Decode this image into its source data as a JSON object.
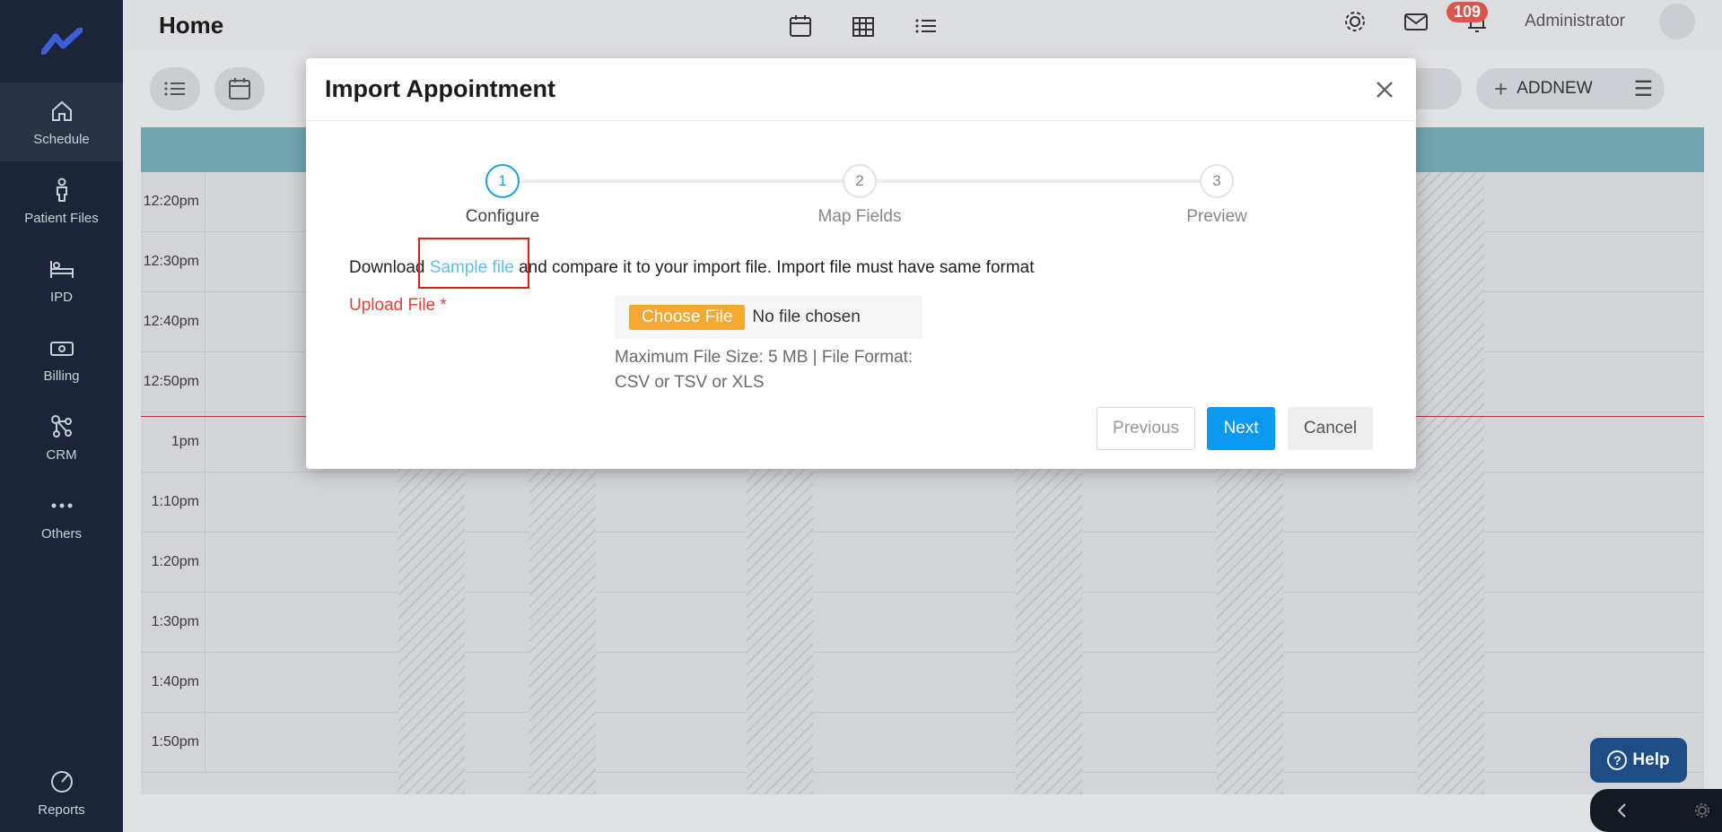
{
  "sidebar": {
    "items": [
      {
        "label": "Schedule",
        "icon": "home-icon"
      },
      {
        "label": "Patient Files",
        "icon": "person-icon"
      },
      {
        "label": "IPD",
        "icon": "bed-icon"
      },
      {
        "label": "Billing",
        "icon": "cash-icon"
      },
      {
        "label": "CRM",
        "icon": "network-icon"
      },
      {
        "label": "Others",
        "icon": "more-dots-icon"
      }
    ],
    "bottom_item": {
      "label": "Reports",
      "icon": "pie-chart-icon"
    }
  },
  "header": {
    "title": "Home",
    "notification_count": "109",
    "user_name": "Administrator"
  },
  "toolbar": {
    "addnew_label": "ADDNEW"
  },
  "schedule": {
    "times": [
      "12:20pm",
      "12:30pm",
      "12:40pm",
      "12:50pm",
      "1pm",
      "1:10pm",
      "1:20pm",
      "1:30pm",
      "1:40pm",
      "1:50pm"
    ]
  },
  "help": {
    "label": "Help"
  },
  "modal": {
    "title": "Import Appointment",
    "steps": [
      {
        "number": "1",
        "label": "Configure"
      },
      {
        "number": "2",
        "label": "Map Fields"
      },
      {
        "number": "3",
        "label": "Preview"
      }
    ],
    "instruction_prefix": "Download",
    "sample_link": "Sample file",
    "instruction_suffix": "and compare it to your import file. Import file must have same format",
    "upload_label": "Upload File *",
    "choose_file_label": "Choose File",
    "no_file_text": "No file chosen",
    "file_hint": "Maximum File Size: 5 MB | File Format: CSV or TSV or XLS",
    "buttons": {
      "previous": "Previous",
      "next": "Next",
      "cancel": "Cancel"
    }
  },
  "colors": {
    "accent": "#0a98f0",
    "link": "#5fc0e8",
    "required": "#e0433b",
    "choose_file": "#f5a833",
    "sidebar_bg": "#1c2537"
  }
}
